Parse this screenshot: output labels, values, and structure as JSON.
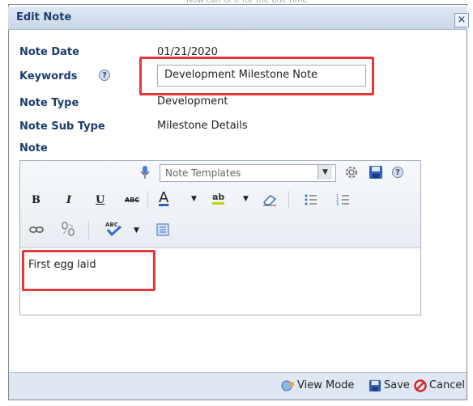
{
  "background_text": "Now can of it for the one time",
  "dialog": {
    "title": "Edit Note",
    "close_glyph": "×"
  },
  "fields": {
    "note_date_label": "Note Date",
    "note_date_value": "01/21/2020",
    "keywords_label": "Keywords",
    "keywords_value": "Development Milestone Note",
    "note_type_label": "Note Type",
    "note_type_value": "Development",
    "note_sub_type_label": "Note Sub Type",
    "note_sub_type_value": "Milestone Details",
    "note_label": "Note"
  },
  "editor": {
    "template_placeholder": "Note Templates",
    "toolbar": {
      "bold": "B",
      "italic": "I",
      "underline": "U",
      "strike": "ABC",
      "font_color": "A",
      "highlight": "ab",
      "spell": "ABC"
    },
    "content": "First egg laid"
  },
  "footer": {
    "view_mode": "View Mode",
    "save": "Save",
    "cancel": "Cancel"
  },
  "colors": {
    "label": "#1b3d6d",
    "highlight_border": "#e5383b",
    "titlebar": "#cad7e8"
  }
}
